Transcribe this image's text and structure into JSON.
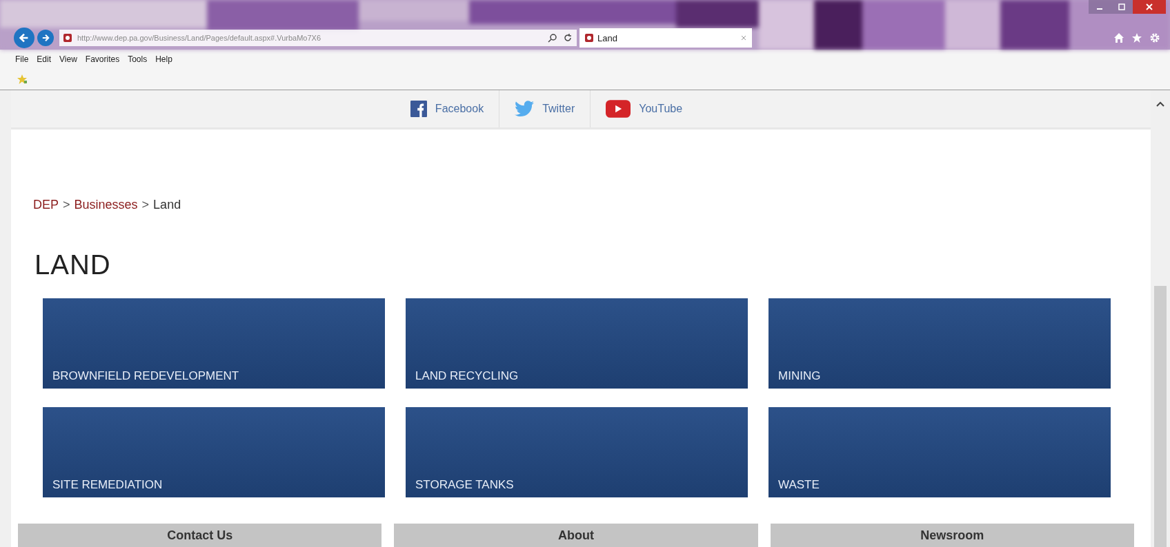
{
  "browser": {
    "address": "http://www.dep.pa.gov/Business/Land/Pages/default.aspx#.VurbaMo7X6",
    "tab": {
      "title": "Land",
      "selected": true
    }
  },
  "menu": [
    "File",
    "Edit",
    "View",
    "Favorites",
    "Tools",
    "Help"
  ],
  "social": [
    {
      "kind": "facebook",
      "label": "Facebook"
    },
    {
      "kind": "twitter",
      "label": "Twitter"
    },
    {
      "kind": "youtube",
      "label": "YouTube"
    }
  ],
  "breadcrumb": [
    {
      "label": "DEP",
      "link": true
    },
    {
      "label": "Businesses",
      "link": true
    },
    {
      "label": "Land",
      "link": false
    }
  ],
  "breadcrumb_separator": ">",
  "heading": "LAND",
  "tiles": [
    "BROWNFIELD REDEVELOPMENT",
    "LAND RECYCLING",
    "MINING",
    "SITE REMEDIATION",
    "STORAGE TANKS",
    "WASTE"
  ],
  "footer": [
    "Contact Us",
    "About",
    "Newsroom"
  ]
}
